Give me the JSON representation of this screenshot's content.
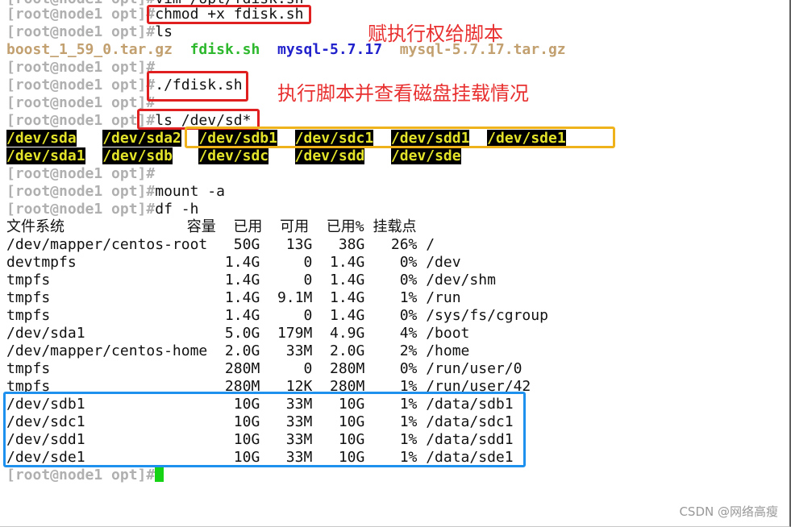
{
  "terminal": {
    "prompt": "[root@node1 opt]#",
    "lines": {
      "top": "vim /opt/fdisk.sh",
      "chmod": "chmod +x fdisk.sh",
      "ls": "ls",
      "run": "./fdisk.sh",
      "ls_dev": "ls /dev/sd*",
      "mount": "mount -a",
      "df": "df -h"
    },
    "ls_output": {
      "boost": "boost_1_59_0.tar.gz",
      "fdisk": "fdisk.sh",
      "mysql_dir": "mysql-5.7.17",
      "mysql_gz": "mysql-5.7.17.tar.gz"
    },
    "devices_row1": [
      "/dev/sda",
      "/dev/sda2",
      "/dev/sdb1",
      "/dev/sdc1",
      "/dev/sdd1",
      "/dev/sde1"
    ],
    "devices_row2": [
      "/dev/sda1",
      "/dev/sdb",
      "/dev/sdc",
      "/dev/sdd",
      "/dev/sde"
    ],
    "df": {
      "headers": [
        "文件系统",
        "容量",
        "已用",
        "可用",
        "已用%",
        "挂载点"
      ],
      "rows": [
        [
          "/dev/mapper/centos-root",
          "50G",
          "13G",
          "38G",
          "26%",
          "/"
        ],
        [
          "devtmpfs",
          "1.4G",
          "0",
          "1.4G",
          "0%",
          "/dev"
        ],
        [
          "tmpfs",
          "1.4G",
          "0",
          "1.4G",
          "0%",
          "/dev/shm"
        ],
        [
          "tmpfs",
          "1.4G",
          "9.1M",
          "1.4G",
          "1%",
          "/run"
        ],
        [
          "tmpfs",
          "1.4G",
          "0",
          "1.4G",
          "0%",
          "/sys/fs/cgroup"
        ],
        [
          "/dev/sda1",
          "5.0G",
          "179M",
          "4.9G",
          "4%",
          "/boot"
        ],
        [
          "/dev/mapper/centos-home",
          "2.0G",
          "33M",
          "2.0G",
          "2%",
          "/home"
        ],
        [
          "tmpfs",
          "280M",
          "0",
          "280M",
          "0%",
          "/run/user/0"
        ],
        [
          "tmpfs",
          "280M",
          "12K",
          "280M",
          "1%",
          "/run/user/42"
        ],
        [
          "/dev/sdb1",
          "10G",
          "33M",
          "10G",
          "1%",
          "/data/sdb1"
        ],
        [
          "/dev/sdc1",
          "10G",
          "33M",
          "10G",
          "1%",
          "/data/sdc1"
        ],
        [
          "/dev/sdd1",
          "10G",
          "33M",
          "10G",
          "1%",
          "/data/sdd1"
        ],
        [
          "/dev/sde1",
          "10G",
          "33M",
          "10G",
          "1%",
          "/data/sde1"
        ]
      ]
    }
  },
  "annotations": {
    "chmod_note": "赋执行权给脚本",
    "run_note": "执行脚本并查看磁盘挂载情况"
  },
  "watermark": "CSDN @网络高瘦",
  "colors": {
    "prompt": "#b0b0b0",
    "highlight_red": "#e02020",
    "highlight_yellow": "#f0b21a",
    "highlight_blue": "#1e90ee",
    "cursor": "#16d316"
  }
}
